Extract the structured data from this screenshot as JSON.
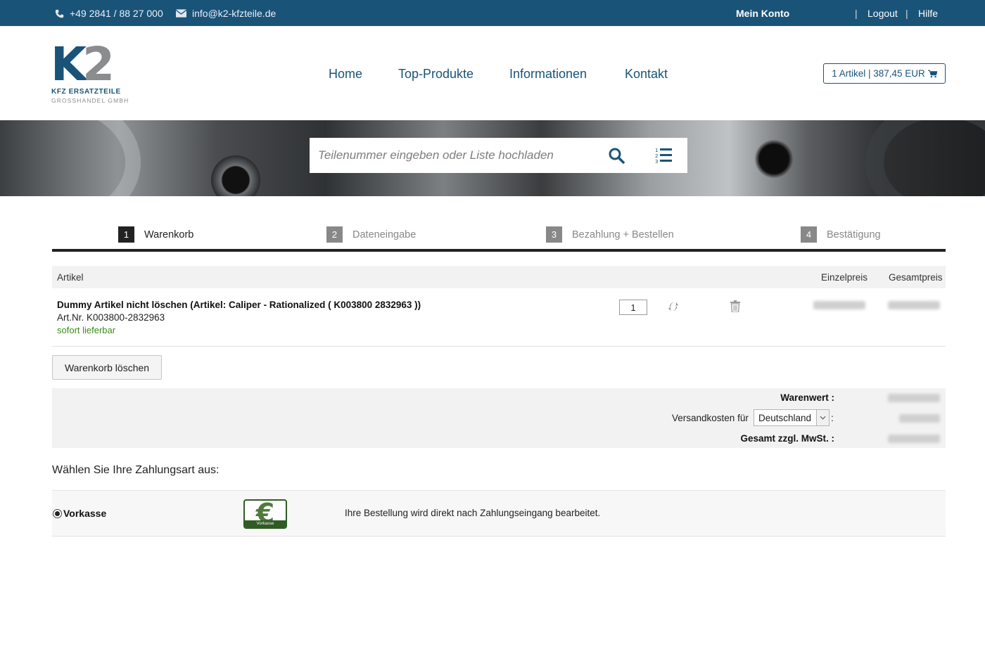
{
  "topbar": {
    "phone": "+49 2841 / 88 27 000",
    "email": "info@k2-kfzteile.de",
    "account": "Mein Konto",
    "separator": "|",
    "logout": "Logout",
    "help": "Hilfe"
  },
  "header": {
    "logo": {
      "k": "K",
      "two": "2",
      "line1": "KFZ ERSATZTEILE",
      "line2": "GROSSHANDEL GMBH"
    },
    "nav": [
      {
        "label": "Home"
      },
      {
        "label": "Top-Produkte"
      },
      {
        "label": "Informationen"
      },
      {
        "label": "Kontakt"
      }
    ],
    "cart_summary": "1 Artikel | 387,45 EUR"
  },
  "search": {
    "placeholder": "Teilenummer eingeben oder Liste hochladen",
    "icons": [
      "search-icon",
      "numbered-list-icon"
    ]
  },
  "steps": [
    {
      "num": "1",
      "label": "Warenkorb",
      "active": true
    },
    {
      "num": "2",
      "label": "Dateneingabe",
      "active": false
    },
    {
      "num": "3",
      "label": "Bezahlung + Bestellen",
      "active": false
    },
    {
      "num": "4",
      "label": "Bestätigung",
      "active": false
    }
  ],
  "cart": {
    "columns": {
      "article": "Artikel",
      "unit_price": "Einzelpreis",
      "total_price": "Gesamtpreis"
    },
    "items": [
      {
        "name": "Dummy Artikel nicht löschen (Artikel: Caliper - Rationalized ( K003800 2832963 ))",
        "art_nr": "Art.Nr. K003800-2832963",
        "availability": "sofort lieferbar",
        "quantity": "1"
      }
    ],
    "clear_button": "Warenkorb löschen"
  },
  "summary": {
    "goods_value_label": "Warenwert :",
    "shipping_label": "Versandkosten für",
    "shipping_country": "Deutschland",
    "shipping_colon": ":",
    "total_label": "Gesamt zzgl. MwSt. :"
  },
  "payment": {
    "title": "Wählen Sie Ihre Zahlungsart aus:",
    "options": [
      {
        "name": "Vorkasse",
        "logo_symbol": "€",
        "logo_label": "Vorkasse",
        "description": "Ihre Bestellung wird direkt nach Zahlungseingang bearbeitet.",
        "selected": true
      }
    ]
  },
  "colors": {
    "brand_blue": "#1a5378",
    "logo_gray": "#8a8c8e",
    "available_green": "#3b8a1a",
    "payment_green": "#2f5b24"
  }
}
